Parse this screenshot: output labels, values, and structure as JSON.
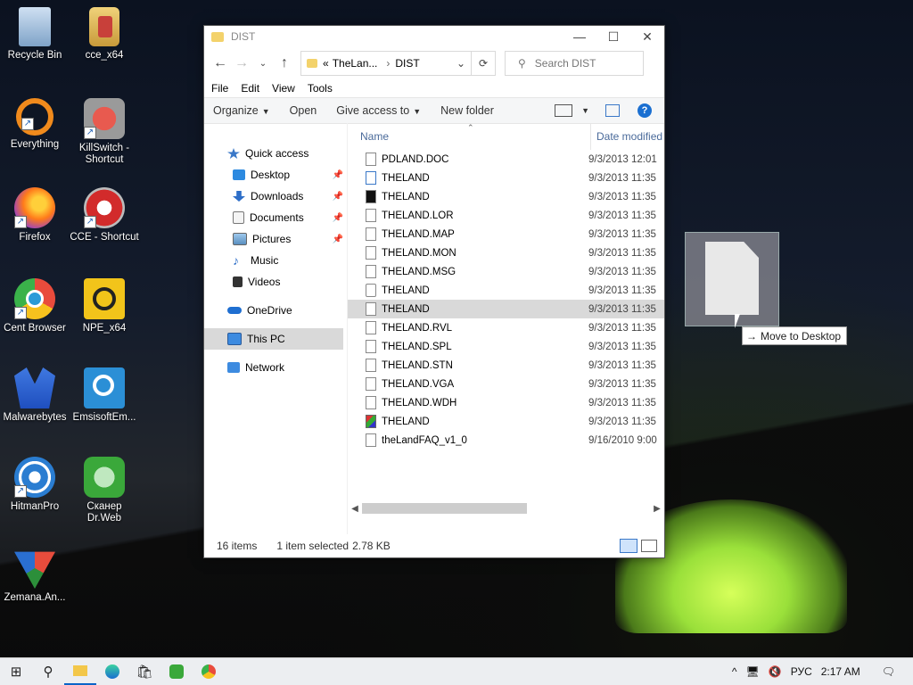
{
  "desktop": {
    "icons": [
      {
        "label": "Recycle Bin",
        "icon": "recycle-bin-icon",
        "color": "#9fb8d8"
      },
      {
        "label": "cce_x64",
        "icon": "cce-folder-icon",
        "color": "#c8403a"
      },
      {
        "label": "Everything",
        "icon": "everything-search-icon",
        "color": "#f08a1c"
      },
      {
        "label": "KillSwitch - Shortcut",
        "icon": "killswitch-icon",
        "color": "#c0392b"
      },
      {
        "label": "Firefox",
        "icon": "firefox-icon",
        "color": "#ff7a1a"
      },
      {
        "label": "CCE - Shortcut",
        "icon": "cce-icon",
        "color": "#d22b2b"
      },
      {
        "label": "Cent Browser",
        "icon": "cent-browser-icon",
        "color": "#2a9bd8"
      },
      {
        "label": "NPE_x64",
        "icon": "npe-icon",
        "color": "#f2c41a"
      },
      {
        "label": "Malwarebytes",
        "icon": "malwarebytes-icon",
        "color": "#1f4fbf"
      },
      {
        "label": "EmsisoftEm...",
        "icon": "emsisoft-icon",
        "color": "#2b8fd6"
      },
      {
        "label": "HitmanPro",
        "icon": "hitmanpro-icon",
        "color": "#2a7dd1"
      },
      {
        "label": "Сканер Dr.Web",
        "icon": "drweb-icon",
        "color": "#3aa83a"
      },
      {
        "label": "Zemana.An...",
        "icon": "zemana-icon",
        "color": "#e74c3c"
      }
    ]
  },
  "explorer": {
    "title": "DIST",
    "address": {
      "prefix": "«",
      "crumb1": "TheLan...",
      "crumb2": "DIST"
    },
    "search_placeholder": "Search DIST",
    "menu": [
      "File",
      "Edit",
      "View",
      "Tools"
    ],
    "commands": {
      "organize": "Organize",
      "open": "Open",
      "give_access": "Give access to",
      "new_folder": "New folder"
    },
    "nav": {
      "quick_access": "Quick access",
      "desktop": "Desktop",
      "downloads": "Downloads",
      "documents": "Documents",
      "pictures": "Pictures",
      "music": "Music",
      "videos": "Videos",
      "onedrive": "OneDrive",
      "this_pc": "This PC",
      "network": "Network"
    },
    "columns": {
      "name": "Name",
      "date": "Date modified"
    },
    "files": [
      {
        "name": "PDLAND.DOC",
        "date": "9/3/2013 12:01"
      },
      {
        "name": "THELAND",
        "date": "9/3/2013 11:35"
      },
      {
        "name": "THELAND",
        "date": "9/3/2013 11:35"
      },
      {
        "name": "THELAND.LOR",
        "date": "9/3/2013 11:35"
      },
      {
        "name": "THELAND.MAP",
        "date": "9/3/2013 11:35"
      },
      {
        "name": "THELAND.MON",
        "date": "9/3/2013 11:35"
      },
      {
        "name": "THELAND.MSG",
        "date": "9/3/2013 11:35"
      },
      {
        "name": "THELAND",
        "date": "9/3/2013 11:35"
      },
      {
        "name": "THELAND",
        "date": "9/3/2013 11:35"
      },
      {
        "name": "THELAND.RVL",
        "date": "9/3/2013 11:35"
      },
      {
        "name": "THELAND.SPL",
        "date": "9/3/2013 11:35"
      },
      {
        "name": "THELAND.STN",
        "date": "9/3/2013 11:35"
      },
      {
        "name": "THELAND.VGA",
        "date": "9/3/2013 11:35"
      },
      {
        "name": "THELAND.WDH",
        "date": "9/3/2013 11:35"
      },
      {
        "name": "THELAND",
        "date": "9/3/2013 11:35"
      },
      {
        "name": "theLandFAQ_v1_0",
        "date": "9/16/2010 9:00"
      }
    ],
    "status": {
      "count": "16 items",
      "selected": "1 item selected",
      "size": "2.78 KB"
    }
  },
  "drag": {
    "tooltip": "Move to Desktop"
  },
  "taskbar": {
    "lang": "РУС",
    "time": "2:17 AM"
  }
}
